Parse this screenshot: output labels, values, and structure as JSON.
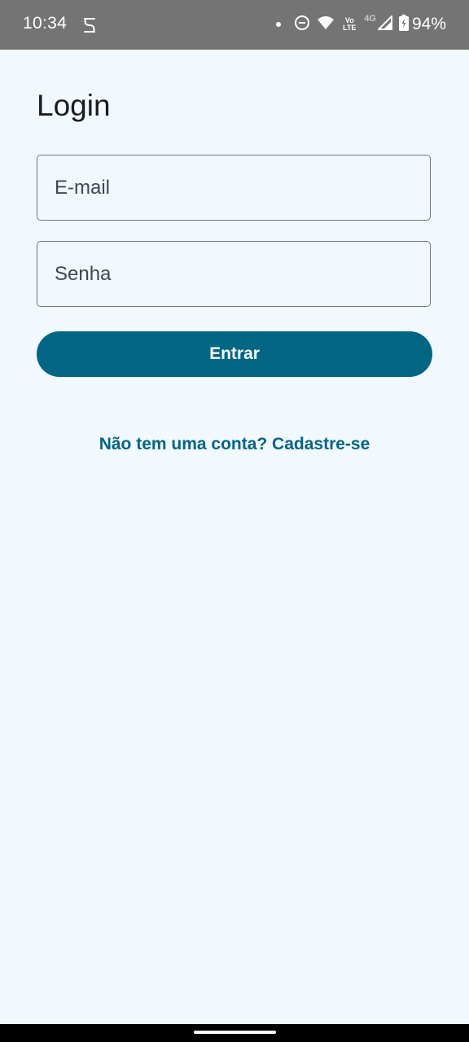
{
  "status_bar": {
    "time": "10:34",
    "left_icon": "notification-s-icon",
    "volte_label_top": "Vo",
    "volte_label_bottom": "LTE",
    "network_label": "4G",
    "battery_percent": "94%",
    "icons": [
      "dot-icon",
      "do-not-disturb-icon",
      "wifi-icon",
      "volte-icon",
      "signal-icon",
      "battery-icon"
    ]
  },
  "screen": {
    "title": "Login"
  },
  "form": {
    "email_placeholder": "E-mail",
    "password_placeholder": "Senha",
    "submit_label": "Entrar"
  },
  "signup": {
    "link_text": "Não tem uma conta? Cadastre-se"
  },
  "colors": {
    "background": "#f1f8fe",
    "primary": "#006684",
    "status_bar": "#747474",
    "outline": "#72787e"
  }
}
